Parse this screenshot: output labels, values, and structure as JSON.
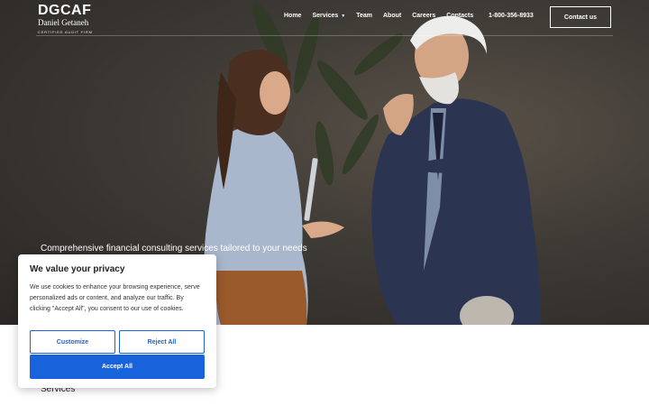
{
  "brand": {
    "mark": "DGCAF",
    "name": "Daniel Getaneh",
    "tagline": "CERTIFIED AUDIT FIRM"
  },
  "nav": {
    "items": [
      {
        "label": "Home"
      },
      {
        "label": "Services"
      },
      {
        "label": "Team"
      },
      {
        "label": "About"
      },
      {
        "label": "Careers"
      },
      {
        "label": "Contacts"
      }
    ],
    "phone": "1-800-356-8933",
    "contact_button": "Contact us"
  },
  "hero": {
    "tagline": "Comprehensive financial consulting services tailored to your needs"
  },
  "section": {
    "heading": "Services"
  },
  "cookie_banner": {
    "title": "We value your privacy",
    "text": "We use cookies to enhance your browsing experience, serve personalized ads or content, and analyze our traffic. By clicking \"Accept All\", you consent to our use of cookies.",
    "customize_label": "Customize",
    "reject_label": "Reject All",
    "accept_label": "Accept All"
  },
  "colors": {
    "accent": "#1863dc",
    "hero_dark": "#2a2825",
    "text_dark": "#212121"
  }
}
